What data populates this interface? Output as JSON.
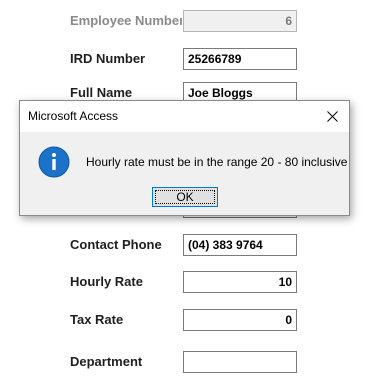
{
  "form": {
    "fields": [
      {
        "label": "Employee Number",
        "value": "6",
        "disabled": true
      },
      {
        "label": "IRD Number",
        "value": "25266789"
      },
      {
        "label": "Full Name",
        "value": "Joe Bloggs"
      },
      {
        "label": "Contact Phone",
        "value": "(04) 383 9764"
      },
      {
        "label": "Hourly Rate",
        "value": "10"
      },
      {
        "label": "Tax Rate",
        "value": "0"
      },
      {
        "label": "Department",
        "value": ""
      }
    ]
  },
  "dialog": {
    "title": "Microsoft Access",
    "icon": "info-icon",
    "message": "Hourly rate must be in the range 20 - 80 inclusive",
    "ok_label": "OK",
    "accent_color": "#0078d7"
  }
}
